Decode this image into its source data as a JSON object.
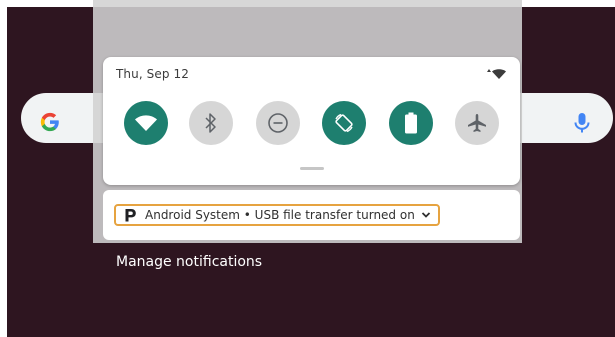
{
  "home": {
    "search_bar": {
      "logo_icon": "google-g-icon",
      "mic_icon": "microphone-icon"
    }
  },
  "quick_settings": {
    "date": "Thu, Sep 12",
    "status_icons": [
      "data-activity-icon",
      "wifi-signal-icon"
    ],
    "tiles": [
      {
        "id": "wifi",
        "icon": "wifi-icon",
        "active": true
      },
      {
        "id": "bluetooth",
        "icon": "bluetooth-icon",
        "active": false
      },
      {
        "id": "do-not-disturb",
        "icon": "do-not-disturb-icon",
        "active": false
      },
      {
        "id": "auto-rotate",
        "icon": "auto-rotate-icon",
        "active": true
      },
      {
        "id": "battery-saver",
        "icon": "battery-icon",
        "active": true
      },
      {
        "id": "airplane-mode",
        "icon": "airplane-icon",
        "active": false
      }
    ]
  },
  "notification": {
    "app_icon": "android-system-p-icon",
    "text": "Android System • USB file transfer turned on",
    "expand_icon": "chevron-down-icon"
  },
  "footer": {
    "manage_label": "Manage notifications"
  },
  "colors": {
    "wallpaper": "#2e1520",
    "tile_active": "#1e7f6f",
    "tile_inactive": "#d6d6d6",
    "focus_outline": "#e6a340"
  }
}
